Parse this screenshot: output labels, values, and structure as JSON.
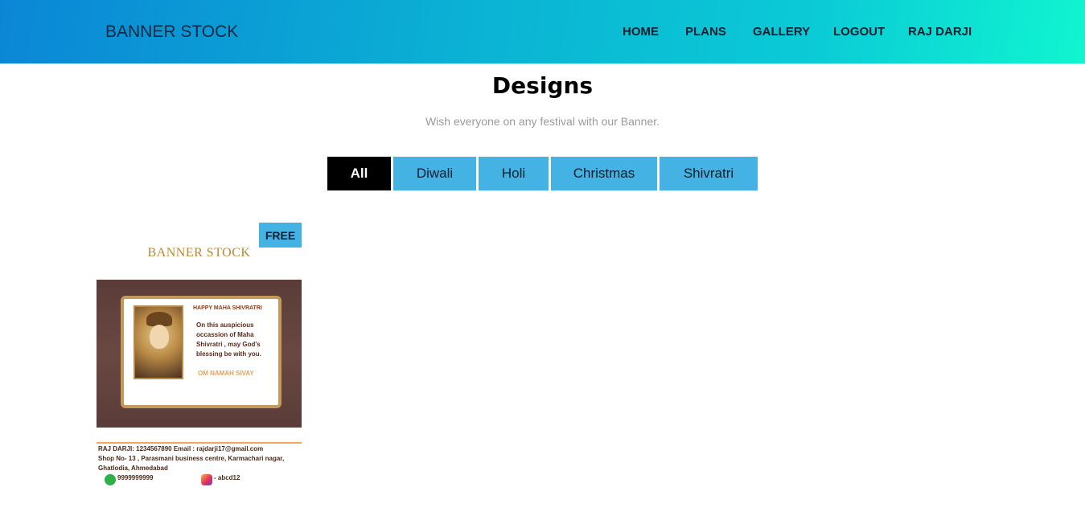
{
  "header": {
    "brand": "BANNER STOCK",
    "nav": [
      "HOME",
      "PLANS",
      "GALLERY",
      "LOGOUT",
      "RAJ DARJI"
    ]
  },
  "main": {
    "title": "Designs",
    "subtitle": "Wish everyone on any festival with our Banner.",
    "filters": [
      "All",
      "Diwali",
      "Holi",
      "Christmas",
      "Shivratri"
    ],
    "active_filter": "All"
  },
  "card": {
    "badge": "FREE",
    "banner": {
      "logo": "BANNER STOCK",
      "greeting_title": "HAPPY MAHA SHIVRATRI",
      "message_lines": [
        "On  this  auspicious",
        "occassion  of  Maha",
        "Shivratri , may God's",
        "blessing be with you."
      ],
      "mantra": "OM NAMAH SIVAY",
      "contact_line1": "RAJ DARJI: 1234567890         Email : rajdarji17@gmail.com",
      "contact_line2": "Shop No- 13 , Parasmani business centre, Karmachari nagar,",
      "contact_line3": "Ghatlodia, Ahmedabad",
      "whatsapp": "9999999999",
      "instagram": "- abcd12"
    }
  },
  "colors": {
    "accent": "#45b2e4",
    "active": "#000000",
    "subtitle": "#9a9a9a"
  },
  "icons": [
    "whatsapp-icon",
    "instagram-icon"
  ]
}
